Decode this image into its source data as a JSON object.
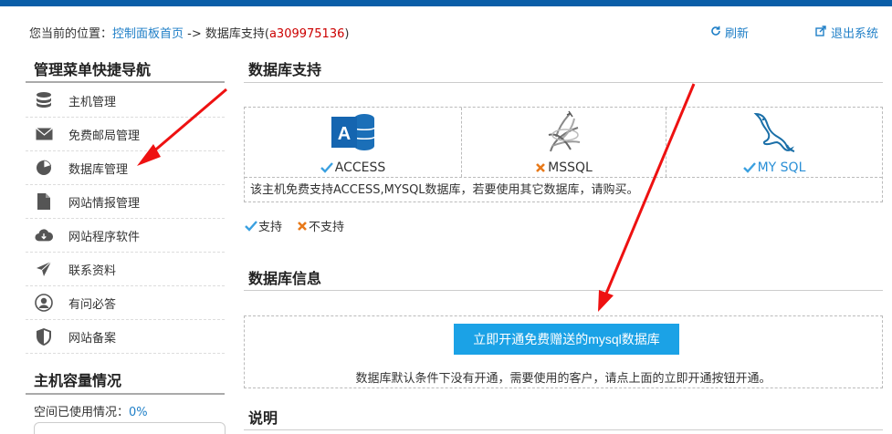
{
  "breadcrumb": {
    "prefix": "您当前的位置：",
    "home": "控制面板首页",
    "sep": " -> ",
    "current": "数据库支持(",
    "account": "a309975136",
    "close": ")"
  },
  "actions": {
    "refresh": "刷新",
    "logout": "退出系统"
  },
  "sidebar": {
    "title": "管理菜单快捷导航",
    "items": [
      {
        "label": "主机管理",
        "icon": "database-icon"
      },
      {
        "label": "免费邮局管理",
        "icon": "envelope-icon"
      },
      {
        "label": "数据库管理",
        "icon": "pie-chart-icon"
      },
      {
        "label": "网站情报管理",
        "icon": "file-icon"
      },
      {
        "label": "网站程序软件",
        "icon": "cloud-download-icon"
      },
      {
        "label": "联系资料",
        "icon": "paper-plane-icon"
      },
      {
        "label": "有问必答",
        "icon": "user-circle-icon"
      },
      {
        "label": "网站备案",
        "icon": "shield-icon"
      }
    ]
  },
  "capacity": {
    "title": "主机容量情况",
    "label": "空间已使用情况：",
    "value": "0%"
  },
  "db_support": {
    "title": "数据库支持",
    "databases": [
      {
        "name": "ACCESS",
        "supported": true
      },
      {
        "name": "MSSQL",
        "supported": false
      },
      {
        "name": "MY SQL",
        "supported": true
      }
    ],
    "note": "该主机免费支持ACCESS,MYSQL数据库，若要使用其它数据库，请购买。"
  },
  "legend": {
    "supported": "支持",
    "unsupported": "不支持"
  },
  "db_info": {
    "title": "数据库信息",
    "button": "立即开通免费赠送的mysql数据库",
    "note": "数据库默认条件下没有开通，需要使用的客户，请点上面的立即开通按钮开通。"
  },
  "desc": {
    "title": "说明"
  },
  "colors": {
    "accent": "#1f7fc7",
    "button": "#1ba2e6",
    "topbar": "#0a5ea8",
    "arrow": "#ee1111",
    "account": "#cc0000"
  }
}
